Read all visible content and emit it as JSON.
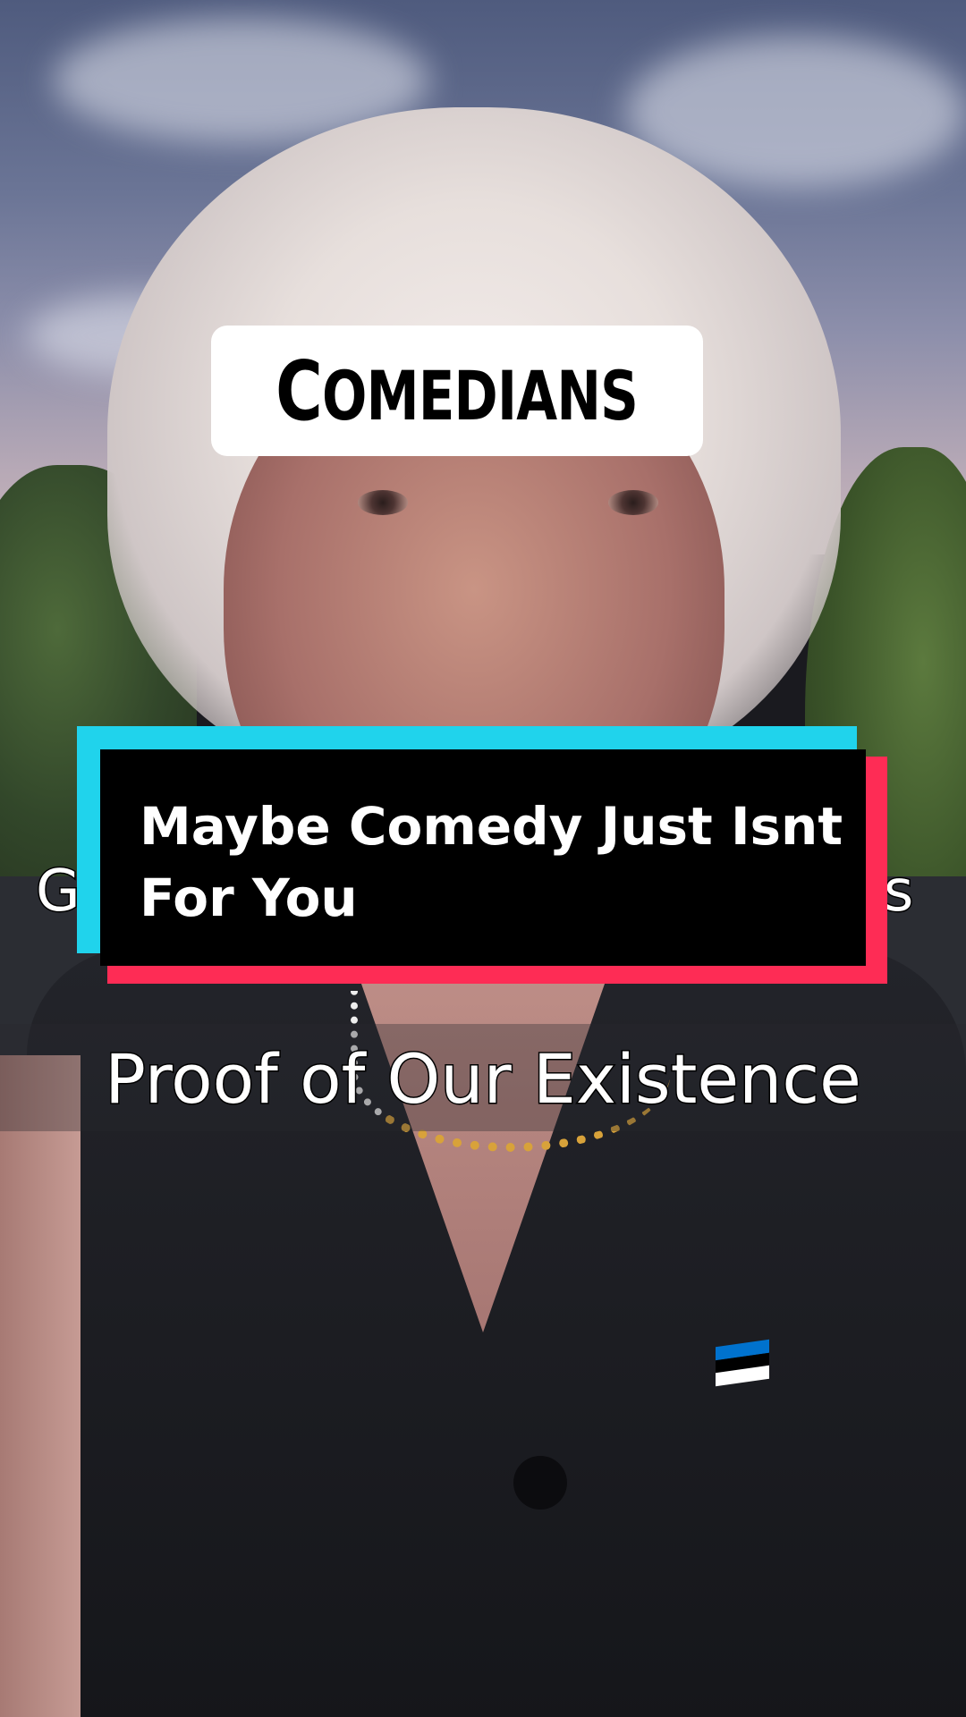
{
  "overlay": {
    "title": "Comedians",
    "caption_card": {
      "line1": "Maybe Comedy Just Isnt",
      "line2": "For You"
    }
  },
  "background_captions": {
    "upper_left_fragment": "G",
    "upper_right_fragment": "s",
    "lower": "Proof of Our Existence"
  },
  "colors": {
    "title_background": "#ffffff",
    "card_background": "#000000",
    "card_accent_cyan": "#20d3ec",
    "card_accent_red": "#fe2c55",
    "flag_blue": "#0072ce",
    "flag_black": "#000000",
    "flag_white": "#ffffff"
  }
}
